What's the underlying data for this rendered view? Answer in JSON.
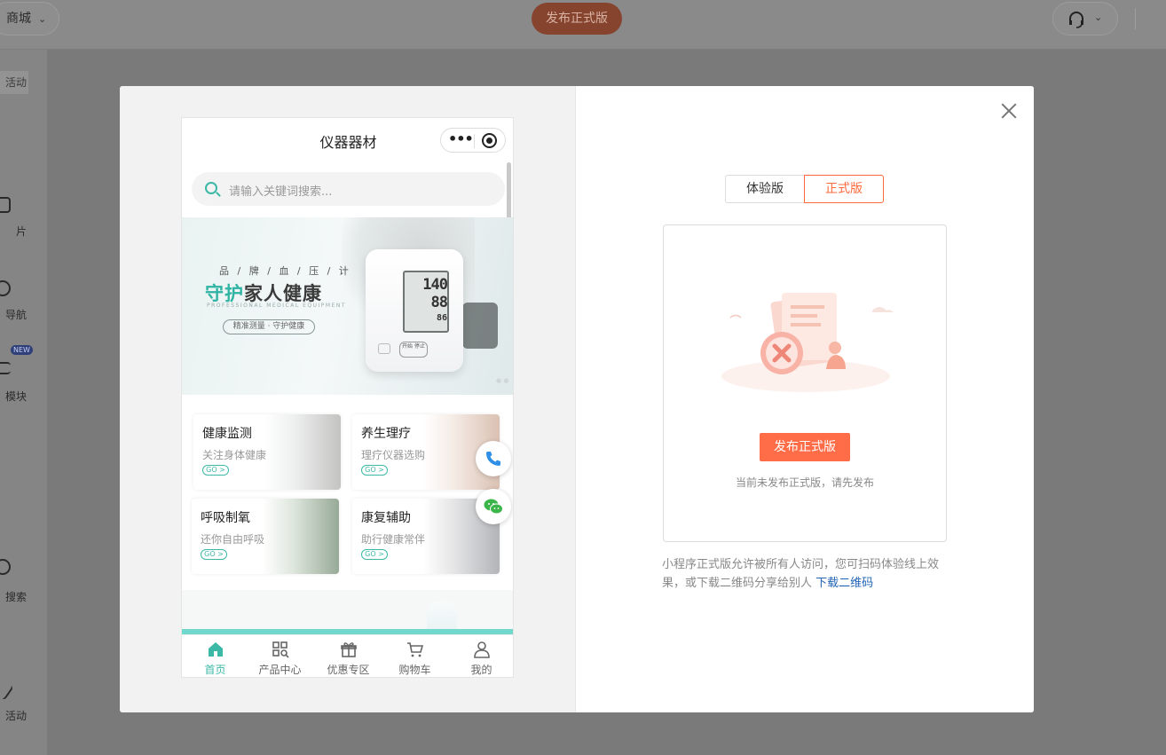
{
  "background": {
    "store_selector": "商城",
    "publish_button": "发布正式版",
    "sidebar": {
      "active": "活动",
      "items": [
        "片",
        "导航",
        "模块",
        "搜索",
        "活动"
      ],
      "new_badge": "NEW"
    }
  },
  "modal": {
    "close_icon": "close-icon",
    "preview": {
      "title": "仪器器材",
      "search_placeholder": "请输入关键词搜索...",
      "banner": {
        "subtitle": "品 / 牌 / 血 / 压 / 计",
        "headline_accent": "守护",
        "headline_rest": "家人健康",
        "english": "PROFESSIONAL MEDICAL EQUIPMENT",
        "pill": "精准测量 · 守护健康",
        "device_readings": [
          "140",
          "88",
          "86"
        ],
        "device_button": "开始 停止"
      },
      "cards": [
        {
          "title": "健康监测",
          "subtitle": "关注身体健康",
          "go": "GO >"
        },
        {
          "title": "养生理疗",
          "subtitle": "理疗仪器选购",
          "go": "GO >"
        },
        {
          "title": "呼吸制氧",
          "subtitle": "还你自由呼吸",
          "go": "GO >"
        },
        {
          "title": "康复辅助",
          "subtitle": "助行健康常伴",
          "go": "GO >"
        }
      ],
      "tabbar": [
        {
          "label": "首页",
          "icon": "home-icon",
          "active": true
        },
        {
          "label": "产品中心",
          "icon": "grid-search-icon",
          "active": false
        },
        {
          "label": "优惠专区",
          "icon": "gift-icon",
          "active": false
        },
        {
          "label": "购物车",
          "icon": "cart-icon",
          "active": false
        },
        {
          "label": "我的",
          "icon": "user-icon",
          "active": false
        }
      ]
    },
    "right": {
      "segment": {
        "trial": "体验版",
        "official": "正式版",
        "selected": "正式版"
      },
      "publish_button": "发布正式版",
      "hint": "当前未发布正式版，请先发布",
      "description": "小程序正式版允许被所有人访问，您可扫码体验线上效果，或下载二维码分享给别人",
      "download_link": "下载二维码"
    }
  },
  "colors": {
    "accent_orange": "#ff6d48",
    "teal": "#3cb8a6",
    "link_blue": "#2163b4"
  }
}
